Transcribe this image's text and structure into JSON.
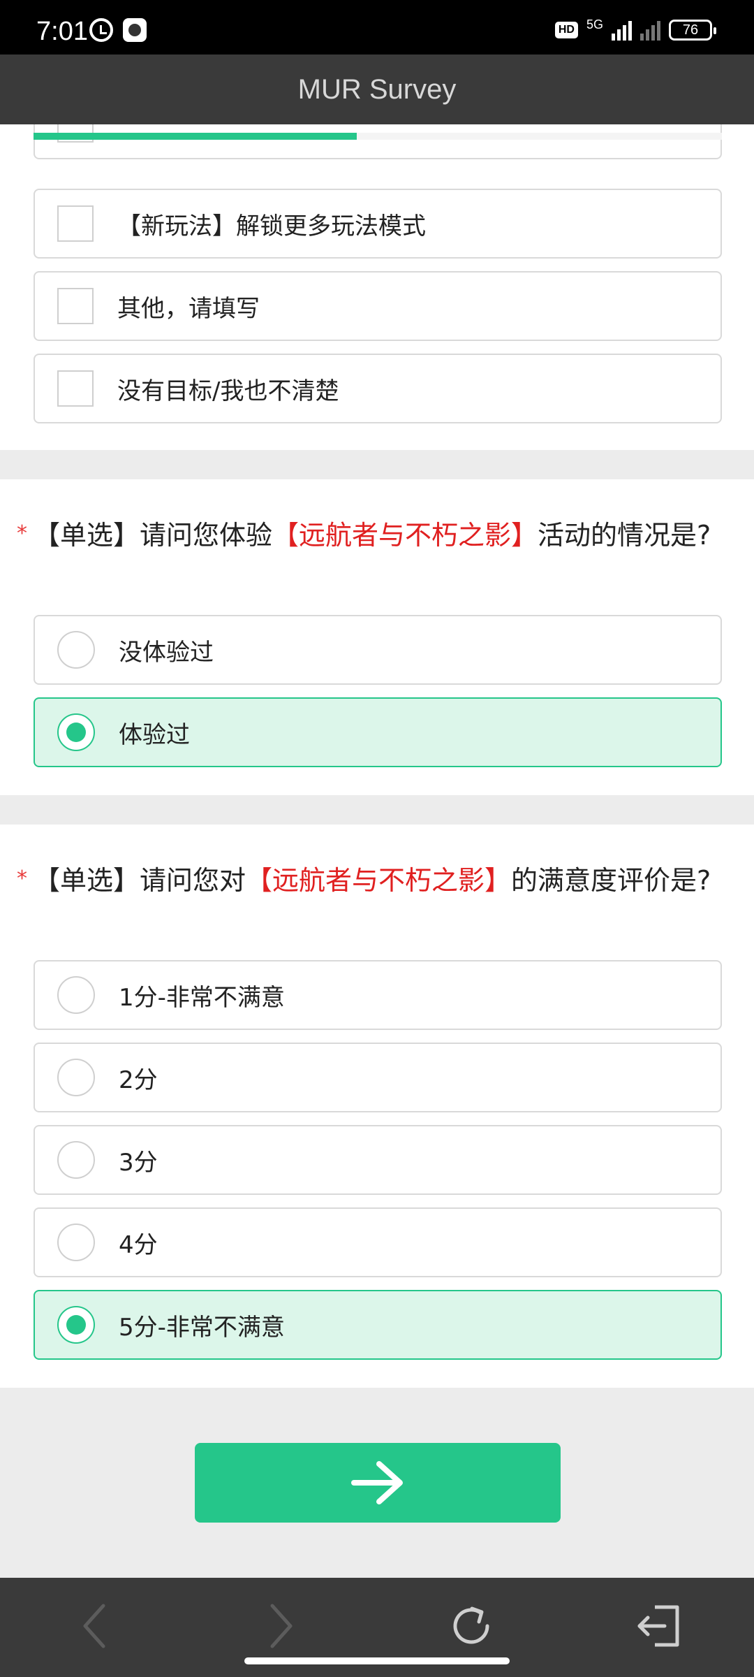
{
  "status_bar": {
    "time": "7:01",
    "hd": "HD",
    "network": "5G",
    "battery": "76"
  },
  "header": {
    "title": "MUR Survey"
  },
  "progress": {
    "fraction": 0.47,
    "color": "#25c68a"
  },
  "question_prev": {
    "options": [
      {
        "label": "【新玩法】解锁更多玩法模式",
        "checked": false
      },
      {
        "label": "其他，请填写",
        "checked": false
      },
      {
        "label": "没有目标/我也不清楚",
        "checked": false
      }
    ]
  },
  "question_experience": {
    "required_mark": "*",
    "title_prefix": "【单选】请问您体验",
    "title_highlight": "【远航者与不朽之影】",
    "title_suffix": "活动的情况是?",
    "options": [
      {
        "label": "没体验过",
        "selected": false
      },
      {
        "label": "体验过",
        "selected": true
      }
    ]
  },
  "question_satisfaction": {
    "required_mark": "*",
    "title_prefix": "【单选】请问您对",
    "title_highlight": "【远航者与不朽之影】",
    "title_suffix": "的满意度评价是?",
    "options": [
      {
        "label": "1分-非常不满意",
        "selected": false
      },
      {
        "label": "2分",
        "selected": false
      },
      {
        "label": "3分",
        "selected": false
      },
      {
        "label": "4分",
        "selected": false
      },
      {
        "label": "5分-非常不满意",
        "selected": true
      }
    ]
  },
  "next": {
    "icon": "arrow-right-icon"
  },
  "bottom_nav": {
    "icons": [
      "back-arrow-icon",
      "forward-arrow-icon",
      "refresh-icon",
      "exit-icon"
    ]
  },
  "colors": {
    "accent": "#25c68a",
    "highlight": "#e02020",
    "selected_bg": "#dcf6ea"
  }
}
